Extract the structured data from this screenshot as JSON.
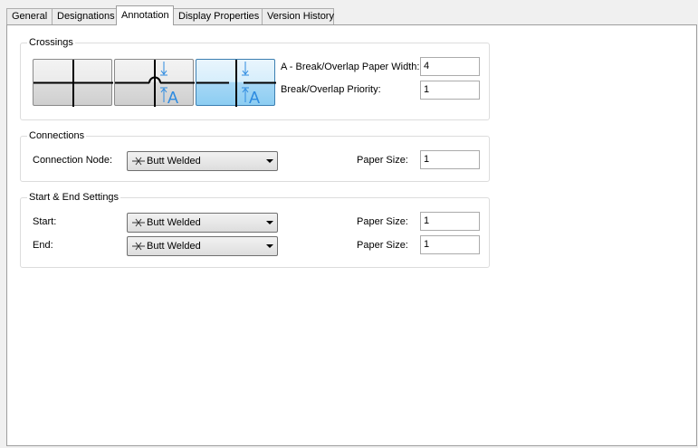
{
  "tabs": [
    {
      "label": "General"
    },
    {
      "label": "Designations"
    },
    {
      "label": "Annotation",
      "active": true
    },
    {
      "label": "Display Properties"
    },
    {
      "label": "Version History"
    }
  ],
  "crossings": {
    "legend": "Crossings",
    "styles": [
      {
        "icon": "plain-cross-icon"
      },
      {
        "icon": "hop-break-icon"
      },
      {
        "icon": "gap-break-icon",
        "selected": true
      }
    ],
    "break_width_label": "A - Break/Overlap Paper Width:",
    "break_width_value": "4",
    "priority_label": "Break/Overlap Priority:",
    "priority_value": "1",
    "icon_letter": "A"
  },
  "connections": {
    "legend": "Connections",
    "node_label": "Connection Node:",
    "node_value": "Butt Welded",
    "paper_size_label": "Paper Size:",
    "paper_size_value": "1"
  },
  "start_end": {
    "legend": "Start & End Settings",
    "start_label": "Start:",
    "start_value": "Butt Welded",
    "start_paper_size_label": "Paper Size:",
    "start_paper_size_value": "1",
    "end_label": "End:",
    "end_value": "Butt Welded",
    "end_paper_size_label": "Paper Size:",
    "end_paper_size_value": "1"
  },
  "colors": {
    "accent": "#3c7fb1",
    "icon_blue": "#2e8be0",
    "selected_fill": "#a8d8f5"
  }
}
